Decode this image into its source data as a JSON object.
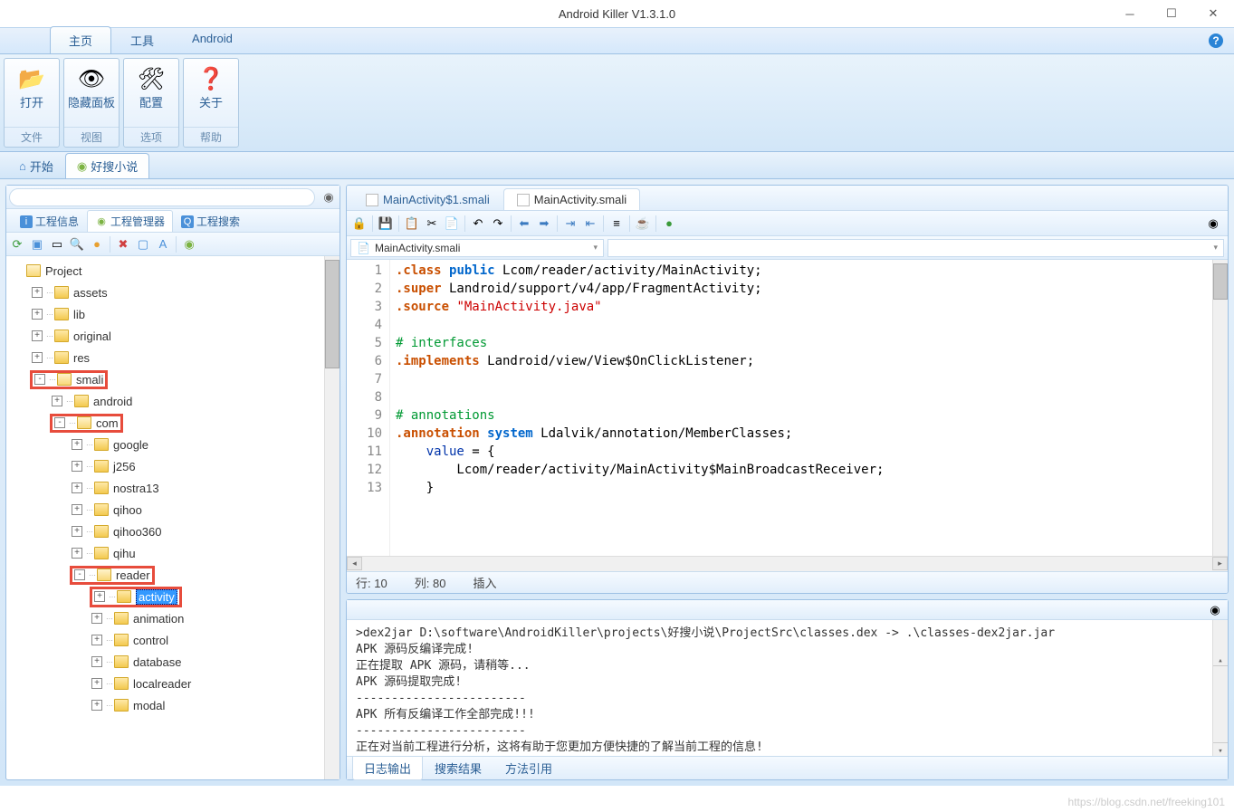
{
  "window": {
    "title": "Android Killer V1.3.1.0"
  },
  "menu": {
    "tabs": [
      "主页",
      "工具",
      "Android"
    ],
    "active": 0
  },
  "ribbon": [
    {
      "label": "打开",
      "group": "文件",
      "icon": "📂"
    },
    {
      "label": "隐藏面板",
      "group": "视图",
      "icon": "👁"
    },
    {
      "label": "配置",
      "group": "选项",
      "icon": "🛠"
    },
    {
      "label": "关于",
      "group": "帮助",
      "icon": "❓"
    }
  ],
  "page_tabs": [
    {
      "label": "开始",
      "icon": "home"
    },
    {
      "label": "好搜小说",
      "icon": "android"
    }
  ],
  "page_tabs_active": 1,
  "left_tabs": [
    "工程信息",
    "工程管理器",
    "工程搜索"
  ],
  "left_tabs_active": 1,
  "tree": [
    {
      "d": 0,
      "e": "",
      "l": "Project",
      "open": true
    },
    {
      "d": 1,
      "e": "+",
      "l": "assets"
    },
    {
      "d": 1,
      "e": "+",
      "l": "lib"
    },
    {
      "d": 1,
      "e": "+",
      "l": "original"
    },
    {
      "d": 1,
      "e": "+",
      "l": "res"
    },
    {
      "d": 1,
      "e": "-",
      "l": "smali",
      "hl": true,
      "open": true
    },
    {
      "d": 2,
      "e": "+",
      "l": "android"
    },
    {
      "d": 2,
      "e": "-",
      "l": "com",
      "hl": true,
      "open": true
    },
    {
      "d": 3,
      "e": "+",
      "l": "google"
    },
    {
      "d": 3,
      "e": "+",
      "l": "j256"
    },
    {
      "d": 3,
      "e": "+",
      "l": "nostra13"
    },
    {
      "d": 3,
      "e": "+",
      "l": "qihoo"
    },
    {
      "d": 3,
      "e": "+",
      "l": "qihoo360"
    },
    {
      "d": 3,
      "e": "+",
      "l": "qihu"
    },
    {
      "d": 3,
      "e": "-",
      "l": "reader",
      "hl": true,
      "open": true
    },
    {
      "d": 4,
      "e": "+",
      "l": "activity",
      "hl": true,
      "sel": true
    },
    {
      "d": 4,
      "e": "+",
      "l": "animation"
    },
    {
      "d": 4,
      "e": "+",
      "l": "control"
    },
    {
      "d": 4,
      "e": "+",
      "l": "database"
    },
    {
      "d": 4,
      "e": "+",
      "l": "localreader"
    },
    {
      "d": 4,
      "e": "+",
      "l": "modal"
    }
  ],
  "file_tabs": [
    {
      "label": "MainActivity$1.smali"
    },
    {
      "label": "MainActivity.smali"
    }
  ],
  "file_tabs_active": 1,
  "crumb": "MainActivity.smali",
  "code": {
    "lines": [
      {
        "n": 1,
        "s": [
          {
            "c": "dir",
            "t": ".class"
          },
          {
            "t": " "
          },
          {
            "c": "kw",
            "t": "public"
          },
          {
            "t": " Lcom/reader/activity/MainActivity;"
          }
        ]
      },
      {
        "n": 2,
        "s": [
          {
            "c": "dir",
            "t": ".super"
          },
          {
            "t": " Landroid/support/v4/app/FragmentActivity;"
          }
        ]
      },
      {
        "n": 3,
        "s": [
          {
            "c": "dir",
            "t": ".source"
          },
          {
            "t": " "
          },
          {
            "c": "str",
            "t": "\"MainActivity.java\""
          }
        ]
      },
      {
        "n": 4,
        "s": []
      },
      {
        "n": 5,
        "s": [
          {
            "c": "com",
            "t": "# interfaces"
          }
        ]
      },
      {
        "n": 6,
        "s": [
          {
            "c": "dir",
            "t": ".implements"
          },
          {
            "t": " Landroid/view/View$OnClickListener;"
          }
        ]
      },
      {
        "n": 7,
        "s": []
      },
      {
        "n": 8,
        "s": []
      },
      {
        "n": 9,
        "s": [
          {
            "c": "com",
            "t": "# annotations"
          }
        ]
      },
      {
        "n": 10,
        "s": [
          {
            "c": "dir",
            "t": ".annotation"
          },
          {
            "t": " "
          },
          {
            "c": "kw",
            "t": "system"
          },
          {
            "t": " Ldalvik/annotation/MemberClasses;"
          }
        ]
      },
      {
        "n": 11,
        "s": [
          {
            "t": "    "
          },
          {
            "c": "id",
            "t": "value"
          },
          {
            "t": " = {"
          }
        ]
      },
      {
        "n": 12,
        "s": [
          {
            "t": "        Lcom/reader/activity/MainActivity$MainBroadcastReceiver;"
          }
        ]
      },
      {
        "n": 13,
        "s": [
          {
            "t": "    }"
          }
        ]
      }
    ]
  },
  "editor_status": {
    "row_label": "行:",
    "row": "10",
    "col_label": "列:",
    "col": "80",
    "mode": "插入"
  },
  "console": [
    ">dex2jar D:\\software\\AndroidKiller\\projects\\好搜小说\\ProjectSrc\\classes.dex -> .\\classes-dex2jar.jar",
    "APK 源码反编译完成!",
    "正在提取 APK 源码，请稍等...",
    "APK 源码提取完成!",
    "------------------------",
    "APK 所有反编译工作全部完成!!!",
    "------------------------",
    "正在对当前工程进行分析，这将有助于您更加方便快捷的了解当前工程的信息!"
  ],
  "console_tabs": [
    "日志输出",
    "搜索结果",
    "方法引用"
  ],
  "console_tabs_active": 0,
  "watermark": "https://blog.csdn.net/freeking101"
}
